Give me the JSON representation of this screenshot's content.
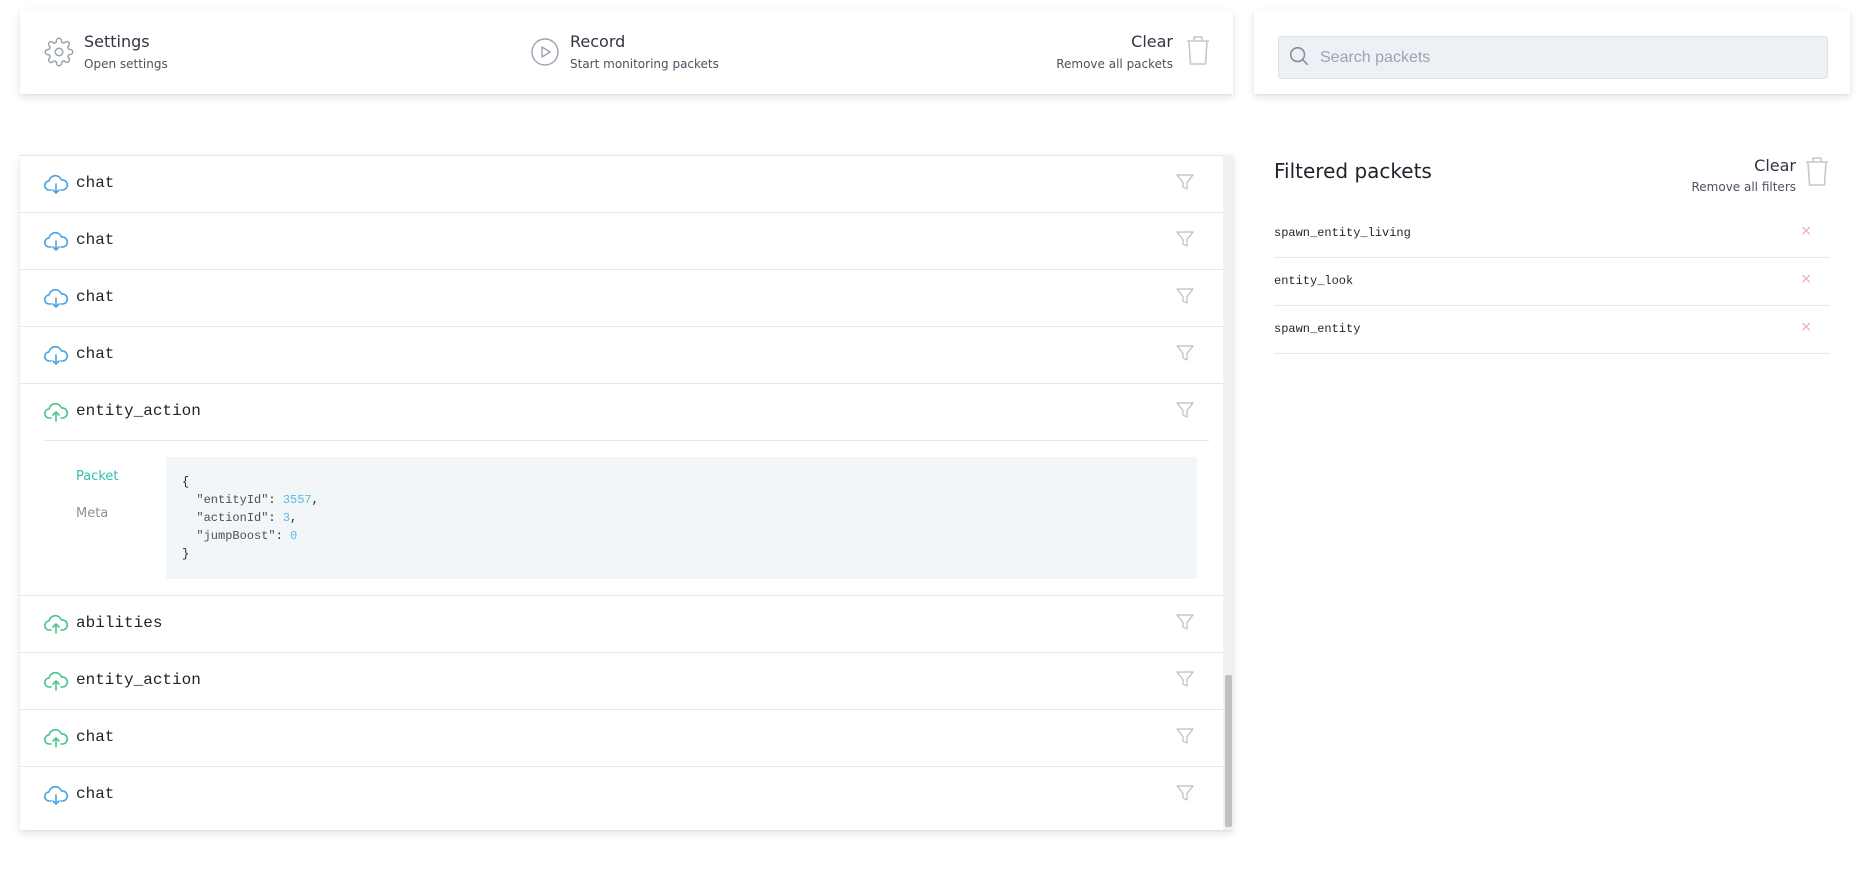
{
  "toolbar": {
    "settings": {
      "label": "Settings",
      "sub": "Open settings",
      "icon": "gear-icon"
    },
    "record": {
      "label": "Record",
      "sub": "Start monitoring packets",
      "icon": "play-circle-icon"
    },
    "clear": {
      "label": "Clear",
      "sub": "Remove all packets",
      "icon": "trash-icon"
    }
  },
  "search": {
    "placeholder": "Search packets",
    "value": ""
  },
  "colors": {
    "incoming": "#4aa3df",
    "outgoing": "#4cc38a",
    "accent": "#2ebfb0",
    "remove": "#f4a5ad"
  },
  "packets": [
    {
      "name": "chat",
      "direction": "incoming"
    },
    {
      "name": "chat",
      "direction": "incoming"
    },
    {
      "name": "chat",
      "direction": "incoming"
    },
    {
      "name": "chat",
      "direction": "incoming"
    },
    {
      "name": "entity_action",
      "direction": "outgoing"
    },
    {
      "name": "abilities",
      "direction": "outgoing"
    },
    {
      "name": "entity_action",
      "direction": "outgoing"
    },
    {
      "name": "chat",
      "direction": "outgoing"
    },
    {
      "name": "chat",
      "direction": "incoming"
    }
  ],
  "details": {
    "tabs": {
      "packet": "Packet",
      "meta": "Meta"
    },
    "fields": [
      {
        "key": "\"entityId\"",
        "value": "3557"
      },
      {
        "key": "\"actionId\"",
        "value": "3"
      },
      {
        "key": "\"jumpBoost\"",
        "value": "0"
      }
    ]
  },
  "filters": {
    "title": "Filtered packets",
    "clear": {
      "label": "Clear",
      "sub": "Remove all filters",
      "icon": "trash-icon"
    },
    "items": [
      "spawn_entity_living",
      "entity_look",
      "spawn_entity"
    ],
    "remove_symbol": "×"
  }
}
